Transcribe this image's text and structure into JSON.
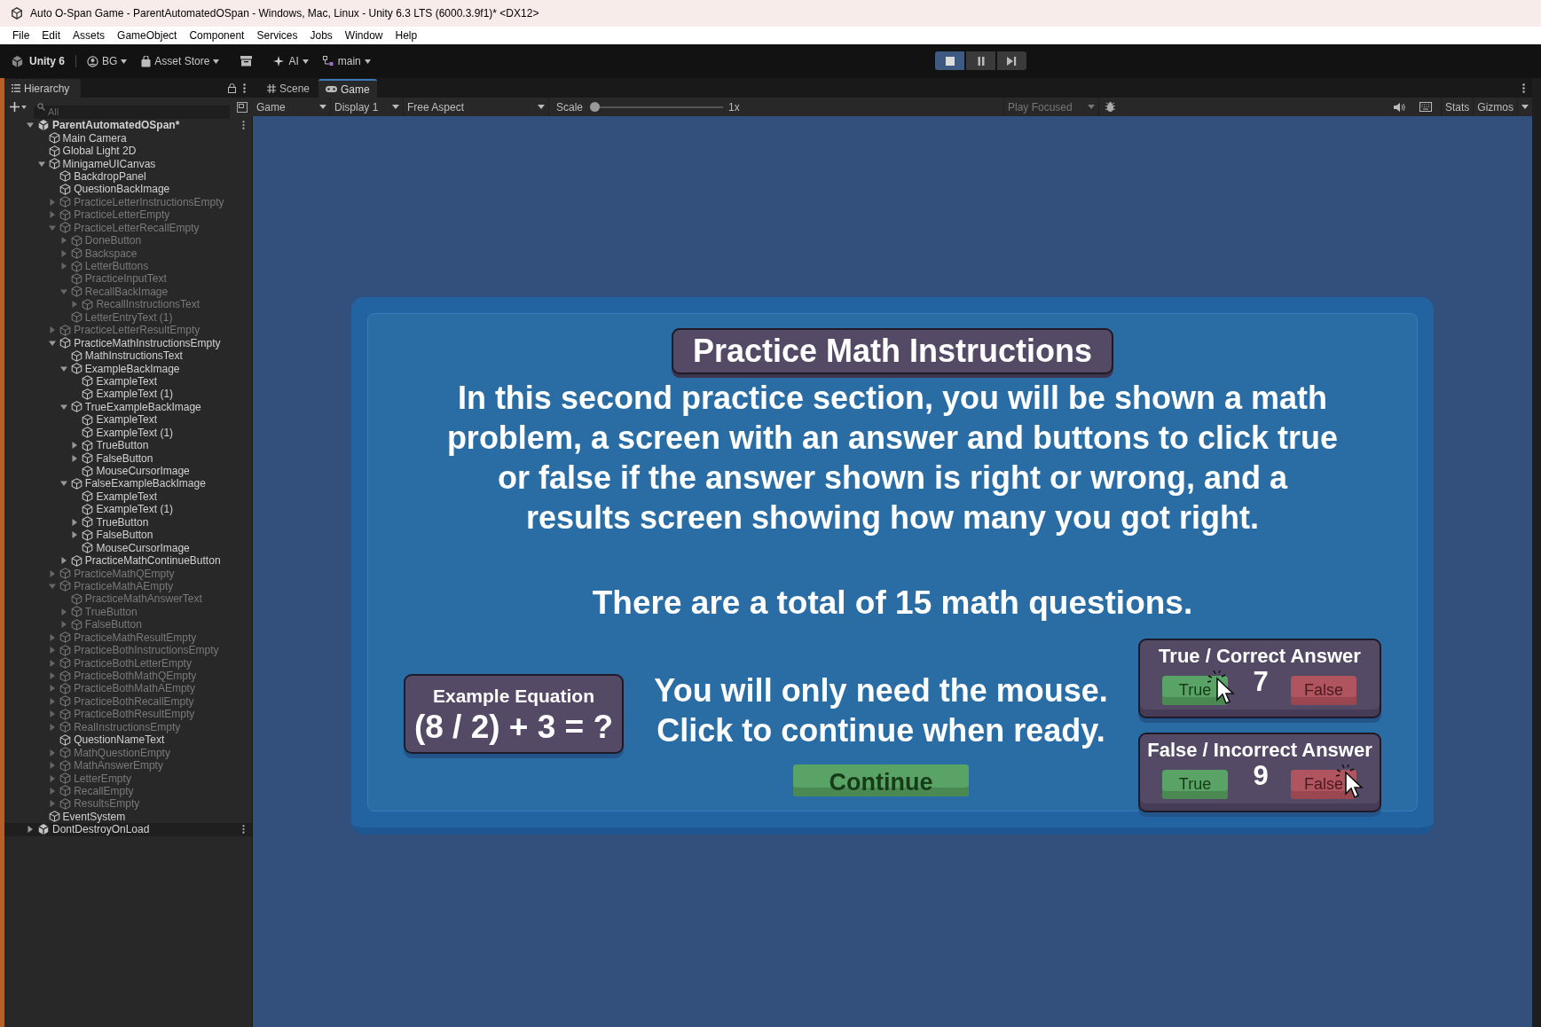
{
  "window": {
    "title": "Auto O-Span Game - ParentAutomatedOSpan - Windows, Mac, Linux - Unity 6.3 LTS (6000.3.9f1)* <DX12>"
  },
  "menu": [
    "File",
    "Edit",
    "Assets",
    "GameObject",
    "Component",
    "Services",
    "Jobs",
    "Window",
    "Help"
  ],
  "toolbar": {
    "account": "Unity 6",
    "user": "BG",
    "asset_store": "Asset Store",
    "ai": "AI",
    "branch": "main",
    "play_mode": true
  },
  "hierarchy": {
    "tab": "Hierarchy",
    "search_placeholder": "All",
    "tree": [
      {
        "name": "ParentAutomatedOSpan*",
        "kind": "scene",
        "active": true,
        "expanded": true,
        "children": [
          {
            "name": "Main Camera",
            "kind": "object",
            "active": true
          },
          {
            "name": "Global Light 2D",
            "kind": "object",
            "active": true
          },
          {
            "name": "MinigameUICanvas",
            "kind": "object",
            "active": true,
            "expanded": true,
            "children": [
              {
                "name": "BackdropPanel",
                "kind": "object",
                "active": true
              },
              {
                "name": "QuestionBackImage",
                "kind": "object",
                "active": true
              },
              {
                "name": "PracticeLetterInstructionsEmpty",
                "kind": "object",
                "active": false,
                "expanded": false
              },
              {
                "name": "PracticeLetterEmpty",
                "kind": "object",
                "active": false,
                "expanded": false
              },
              {
                "name": "PracticeLetterRecallEmpty",
                "kind": "object",
                "active": false,
                "expanded": true,
                "children": [
                  {
                    "name": "DoneButton",
                    "kind": "object",
                    "active": false,
                    "expanded": false
                  },
                  {
                    "name": "Backspace",
                    "kind": "object",
                    "active": false,
                    "expanded": false
                  },
                  {
                    "name": "LetterButtons",
                    "kind": "object",
                    "active": false,
                    "expanded": false
                  },
                  {
                    "name": "PracticeInputText",
                    "kind": "object",
                    "active": false
                  },
                  {
                    "name": "RecallBackImage",
                    "kind": "object",
                    "active": false,
                    "expanded": true,
                    "children": [
                      {
                        "name": "RecallInstructionsText",
                        "kind": "object",
                        "active": false,
                        "expanded": false
                      }
                    ]
                  },
                  {
                    "name": "LetterEntryText (1)",
                    "kind": "object",
                    "active": false
                  }
                ]
              },
              {
                "name": "PracticeLetterResultEmpty",
                "kind": "object",
                "active": false,
                "expanded": false
              },
              {
                "name": "PracticeMathInstructionsEmpty",
                "kind": "object",
                "active": true,
                "expanded": true,
                "children": [
                  {
                    "name": "MathInstructionsText",
                    "kind": "object",
                    "active": true
                  },
                  {
                    "name": "ExampleBackImage",
                    "kind": "object",
                    "active": true,
                    "expanded": true,
                    "children": [
                      {
                        "name": "ExampleText",
                        "kind": "object",
                        "active": true
                      },
                      {
                        "name": "ExampleText (1)",
                        "kind": "object",
                        "active": true
                      }
                    ]
                  },
                  {
                    "name": "TrueExampleBackImage",
                    "kind": "object",
                    "active": true,
                    "expanded": true,
                    "children": [
                      {
                        "name": "ExampleText",
                        "kind": "object",
                        "active": true
                      },
                      {
                        "name": "ExampleText (1)",
                        "kind": "object",
                        "active": true
                      },
                      {
                        "name": "TrueButton",
                        "kind": "object",
                        "active": true,
                        "expanded": false
                      },
                      {
                        "name": "FalseButton",
                        "kind": "object",
                        "active": true,
                        "expanded": false
                      },
                      {
                        "name": "MouseCursorImage",
                        "kind": "object",
                        "active": true
                      }
                    ]
                  },
                  {
                    "name": "FalseExampleBackImage",
                    "kind": "object",
                    "active": true,
                    "expanded": true,
                    "children": [
                      {
                        "name": "ExampleText",
                        "kind": "object",
                        "active": true
                      },
                      {
                        "name": "ExampleText (1)",
                        "kind": "object",
                        "active": true
                      },
                      {
                        "name": "TrueButton",
                        "kind": "object",
                        "active": true,
                        "expanded": false
                      },
                      {
                        "name": "FalseButton",
                        "kind": "object",
                        "active": true,
                        "expanded": false
                      },
                      {
                        "name": "MouseCursorImage",
                        "kind": "object",
                        "active": true
                      }
                    ]
                  },
                  {
                    "name": "PracticeMathContinueButton",
                    "kind": "object",
                    "active": true,
                    "expanded": false
                  }
                ]
              },
              {
                "name": "PracticeMathQEmpty",
                "kind": "object",
                "active": false,
                "expanded": false
              },
              {
                "name": "PracticeMathAEmpty",
                "kind": "object",
                "active": false,
                "expanded": true,
                "children": [
                  {
                    "name": "PracticeMathAnswerText",
                    "kind": "object",
                    "active": false
                  },
                  {
                    "name": "TrueButton",
                    "kind": "object",
                    "active": false,
                    "expanded": false
                  },
                  {
                    "name": "FalseButton",
                    "kind": "object",
                    "active": false,
                    "expanded": false
                  }
                ]
              },
              {
                "name": "PracticeMathResultEmpty",
                "kind": "object",
                "active": false,
                "expanded": false
              },
              {
                "name": "PracticeBothInstructionsEmpty",
                "kind": "object",
                "active": false,
                "expanded": false
              },
              {
                "name": "PracticeBothLetterEmpty",
                "kind": "object",
                "active": false,
                "expanded": false
              },
              {
                "name": "PracticeBothMathQEmpty",
                "kind": "object",
                "active": false,
                "expanded": false
              },
              {
                "name": "PracticeBothMathAEmpty",
                "kind": "object",
                "active": false,
                "expanded": false
              },
              {
                "name": "PracticeBothRecallEmpty",
                "kind": "object",
                "active": false,
                "expanded": false
              },
              {
                "name": "PracticeBothResultEmpty",
                "kind": "object",
                "active": false,
                "expanded": false
              },
              {
                "name": "RealInstructionsEmpty",
                "kind": "object",
                "active": false,
                "expanded": false
              },
              {
                "name": "QuestionNameText",
                "kind": "object",
                "active": true
              },
              {
                "name": "MathQuestionEmpty",
                "kind": "object",
                "active": false,
                "expanded": false
              },
              {
                "name": "MathAnswerEmpty",
                "kind": "object",
                "active": false,
                "expanded": false
              },
              {
                "name": "LetterEmpty",
                "kind": "object",
                "active": false,
                "expanded": false
              },
              {
                "name": "RecallEmpty",
                "kind": "object",
                "active": false,
                "expanded": false
              },
              {
                "name": "ResultsEmpty",
                "kind": "object",
                "active": false,
                "expanded": false
              }
            ]
          },
          {
            "name": "EventSystem",
            "kind": "object",
            "active": true
          }
        ]
      },
      {
        "name": "DontDestroyOnLoad",
        "kind": "scene",
        "active": true,
        "expanded": false
      }
    ]
  },
  "view_tabs": [
    {
      "label": "Scene",
      "kind": "scene",
      "selected": false
    },
    {
      "label": "Game",
      "kind": "game",
      "selected": true
    }
  ],
  "game_toolbar": {
    "view": "Game",
    "display": "Display 1",
    "aspect": "Free Aspect",
    "scale_label": "Scale",
    "scale": {
      "level": 0
    },
    "scale_value": "1x",
    "play_focus": "Play Focused",
    "stats": "Stats",
    "gizmos": "Gizmos"
  },
  "game": {
    "title": "Practice Math Instructions",
    "paragraph": "In this second practice section, you will be shown a math problem, a screen with an answer and buttons to click true or false if the answer shown is right or wrong, and a results screen showing how many you got right.",
    "total": "There are a total of 15 math questions.",
    "example": {
      "title": "Example Equation",
      "equation": "(8 / 2) + 3 = ?"
    },
    "instructions": "You will only need the mouse.\nClick to continue when ready.",
    "continue": "Continue",
    "examples": [
      {
        "title": "True / Correct Answer",
        "answer": "7",
        "buttons": [
          {
            "label": "True",
            "kind": "true",
            "clicked": true
          },
          {
            "label": "False",
            "kind": "false",
            "clicked": false
          }
        ]
      },
      {
        "title": "False / Incorrect Answer",
        "answer": "9",
        "buttons": [
          {
            "label": "True",
            "kind": "true",
            "clicked": false
          },
          {
            "label": "False",
            "kind": "false",
            "clicked": true
          }
        ]
      }
    ]
  }
}
